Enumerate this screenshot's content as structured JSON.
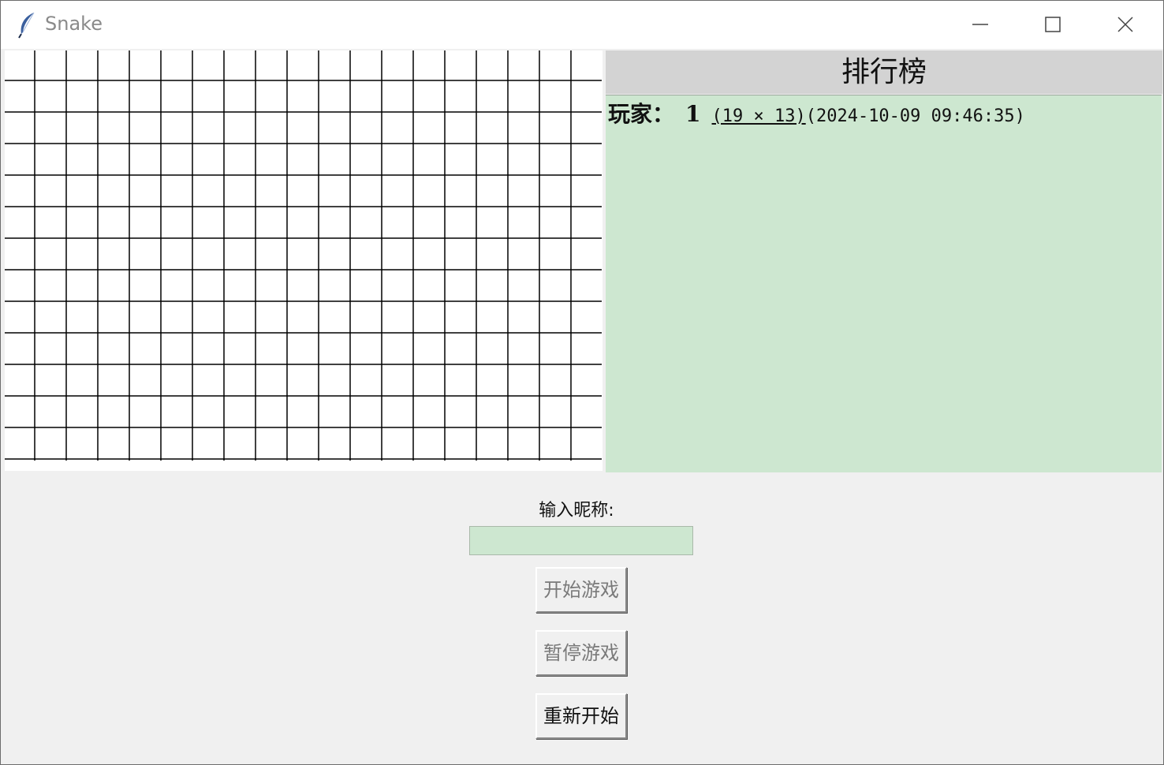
{
  "window": {
    "title": "Snake"
  },
  "board": {
    "columns": 19,
    "rows": 13
  },
  "leaderboard": {
    "title": "排行榜",
    "entries": [
      {
        "player": "玩家：",
        "score": "1",
        "size": "(19 × 13)",
        "time": "(2024-10-09 09:46:35)"
      }
    ]
  },
  "controls": {
    "nickname_label": "输入昵称:",
    "nickname_value": "",
    "start_label": "开始游戏",
    "pause_label": "暂停游戏",
    "restart_label": "重新开始"
  },
  "colors": {
    "leaderboard_header_bg": "#d3d3d3",
    "leaderboard_body_bg": "#cde7d0",
    "input_bg": "#cde7d0",
    "grid_line": "#000000"
  }
}
